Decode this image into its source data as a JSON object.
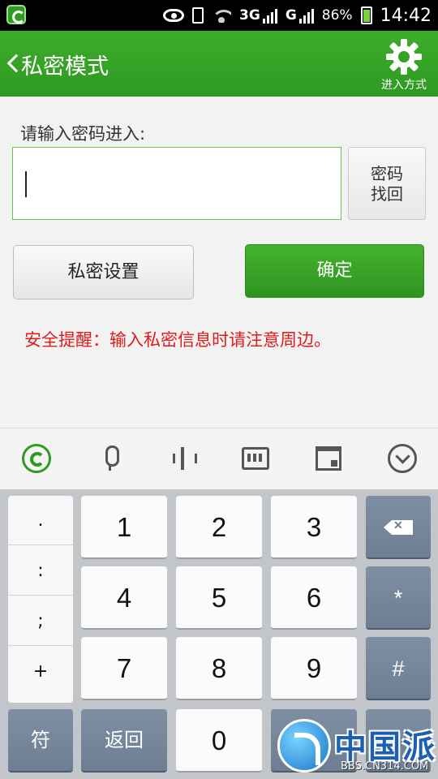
{
  "status_bar": {
    "network": "3G",
    "network2": "G",
    "battery": "86%",
    "time": "14:42"
  },
  "header": {
    "title": "私密模式",
    "settings_label": "进入方式"
  },
  "form": {
    "prompt": "请输入密码进入:",
    "password_value": "",
    "find_password_line1": "密码",
    "find_password_line2": "找回",
    "private_settings_button": "私密设置",
    "confirm_button": "确定",
    "security_tip": "安全提醒：输入私密信息时请注意周边。"
  },
  "keyboard": {
    "toolbar_icons": [
      "app-logo-icon",
      "microphone-icon",
      "text-cursor-icon",
      "keyboard-icon",
      "window-icon",
      "collapse-icon"
    ],
    "symbols": [
      ".",
      ":",
      ";",
      "+"
    ],
    "digits": [
      "1",
      "2",
      "3",
      "4",
      "5",
      "6",
      "7",
      "8",
      "9",
      "0"
    ],
    "star": "*",
    "hash": "#",
    "symbol_key": "符",
    "return_key": "返回"
  },
  "watermark": {
    "text": "中国派",
    "url": "BBS.CN314.COM"
  },
  "colors": {
    "header_green": "#2f9922",
    "confirm_green": "#3aa828",
    "warning_red": "#e01b1b"
  }
}
